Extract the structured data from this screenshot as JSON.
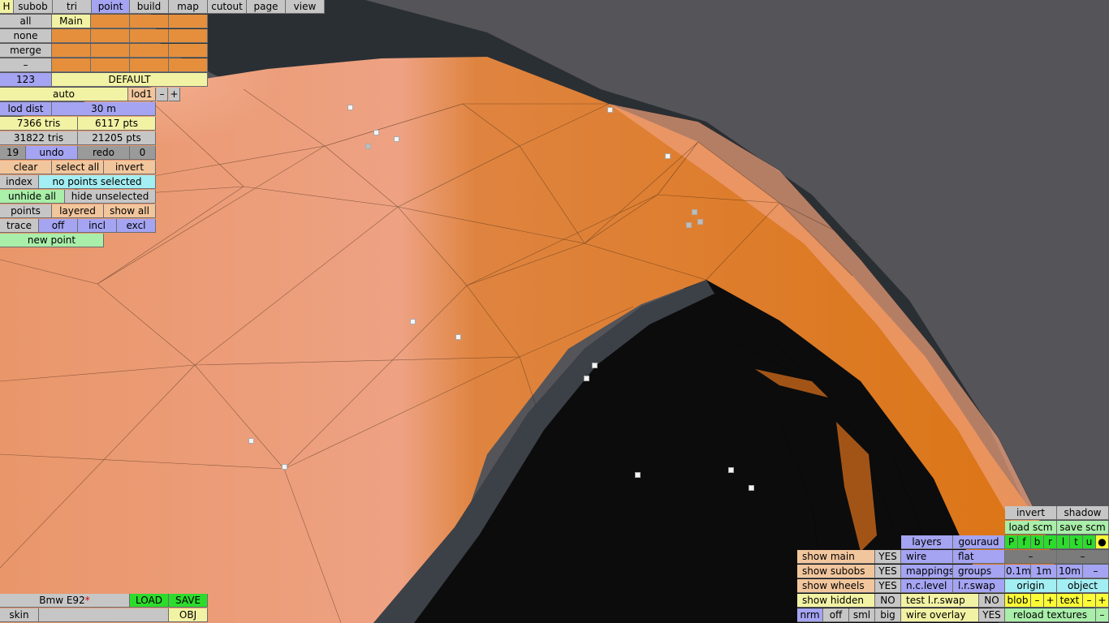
{
  "menu": {
    "h": "H",
    "tabs": [
      "subob",
      "tri",
      "point",
      "build",
      "map",
      "cutout",
      "page",
      "view"
    ],
    "active_tab": "point"
  },
  "subob": {
    "all": "all",
    "main": "Main",
    "none": "none",
    "merge": "merge",
    "dash": "–",
    "num": "123",
    "default": "DEFAULT"
  },
  "lod": {
    "auto": "auto",
    "lod1": "lod1",
    "minus": "–",
    "plus": "+",
    "dist_label": "lod dist",
    "dist_value": "30 m",
    "tris1": "7366 tris",
    "pts1": "6117 pts",
    "tris2": "31822 tris",
    "pts2": "21205 pts"
  },
  "undo": {
    "count": "19",
    "undo": "undo",
    "redo": "redo",
    "redo_count": "0"
  },
  "select": {
    "clear": "clear",
    "select_all": "select all",
    "invert": "invert",
    "index": "index",
    "status": "no points selected",
    "unhide_all": "unhide all",
    "hide_unselected": "hide unselected",
    "points": "points",
    "layered": "layered",
    "show_all": "show all",
    "trace": "trace",
    "off": "off",
    "incl": "incl",
    "excl": "excl",
    "new_point": "new point"
  },
  "file": {
    "name": "Bmw E92",
    "modified": "*",
    "load": "LOAD",
    "save": "SAVE",
    "skin": "skin",
    "obj": "OBJ"
  },
  "view": {
    "show_main": "show main",
    "show_main_v": "YES",
    "show_subobs": "show subobs",
    "show_subobs_v": "YES",
    "show_wheels": "show wheels",
    "show_wheels_v": "YES",
    "show_hidden": "show hidden",
    "show_hidden_v": "NO",
    "nrm": "nrm",
    "off": "off",
    "sml": "sml",
    "big": "big",
    "layers": "layers",
    "gouraud": "gouraud",
    "wire": "wire",
    "flat": "flat",
    "mappings": "mappings",
    "groups": "groups",
    "nclevel": "n.c.level",
    "lrswap": "l.r.swap",
    "test_lrswap": "test l.r.swap",
    "test_lrswap_v": "NO",
    "wire_overlay": "wire overlay",
    "wire_overlay_v": "YES",
    "invert": "invert",
    "shadow": "shadow",
    "load_scm": "load scm",
    "save_scm": "save scm",
    "letters": [
      "P",
      "f",
      "b",
      "r",
      "l",
      "t",
      "u",
      "●"
    ],
    "dash1": "–",
    "dash2": "–",
    "s01": "0.1m",
    "s1": "1m",
    "s10": "10m",
    "sminus": "–",
    "origin": "origin",
    "object": "object",
    "blob": "blob",
    "blob_minus": "–",
    "blob_plus": "+",
    "text": "text",
    "text_minus": "–",
    "text_plus": "+",
    "reload_textures": "reload textures",
    "rt_minus": "–"
  }
}
